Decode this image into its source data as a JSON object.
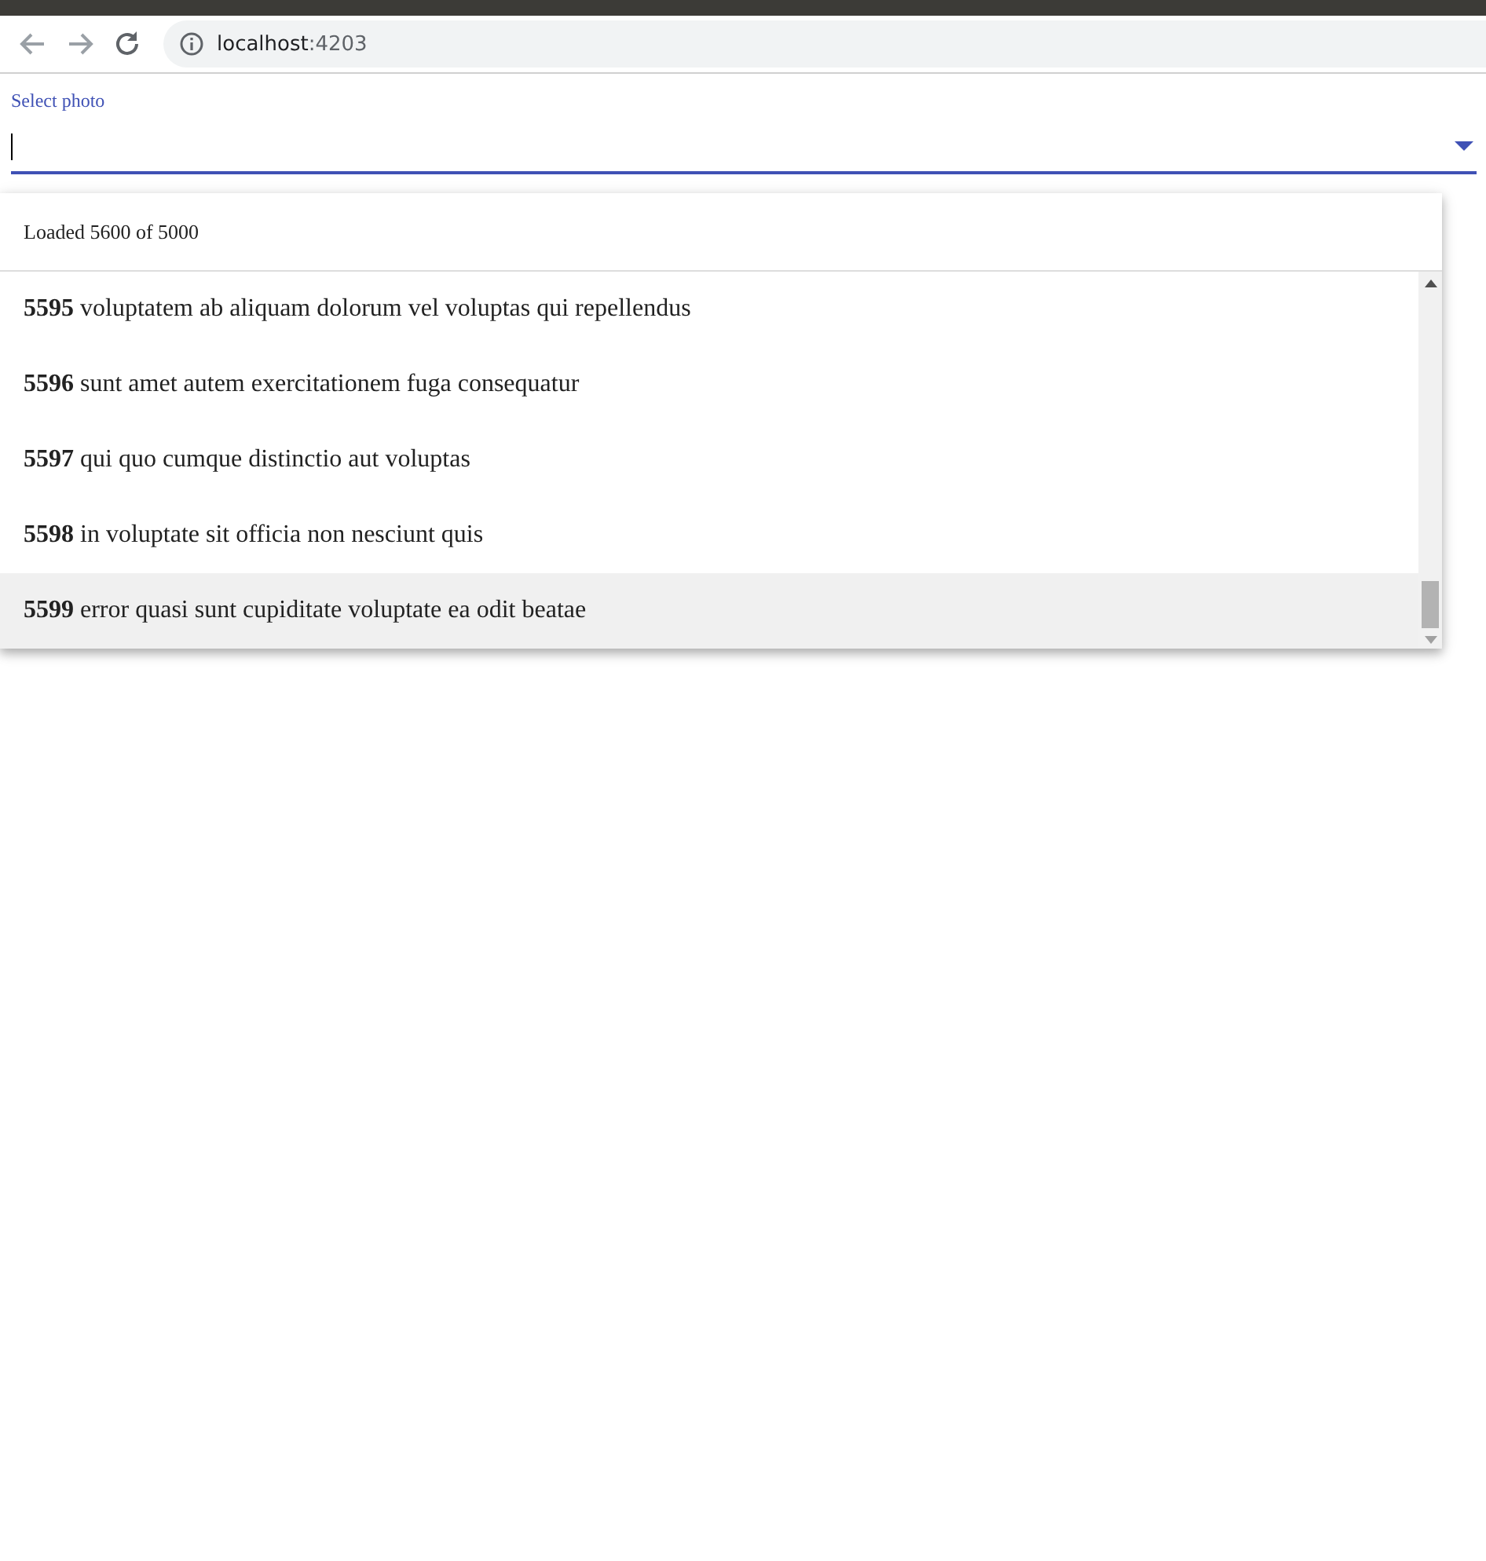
{
  "browser": {
    "address": {
      "host": "localhost",
      "port": ":4203"
    }
  },
  "select": {
    "label": "Select photo",
    "status": "Loaded 5600 of 5000",
    "options": [
      {
        "text": "**5595** voluptatem ab aliquam dolorum vel voluptas qui repellendus",
        "highlighted": false
      },
      {
        "text": "**5596** sunt amet autem exercitationem fuga consequatur",
        "highlighted": false
      },
      {
        "text": "**5597** qui quo cumque distinctio aut voluptas",
        "highlighted": false
      },
      {
        "text": "**5598** in voluptate sit officia non nesciunt quis",
        "highlighted": false
      },
      {
        "text": "**5599** error quasi sunt cupiditate voluptate ea odit beatae",
        "highlighted": true
      }
    ]
  }
}
